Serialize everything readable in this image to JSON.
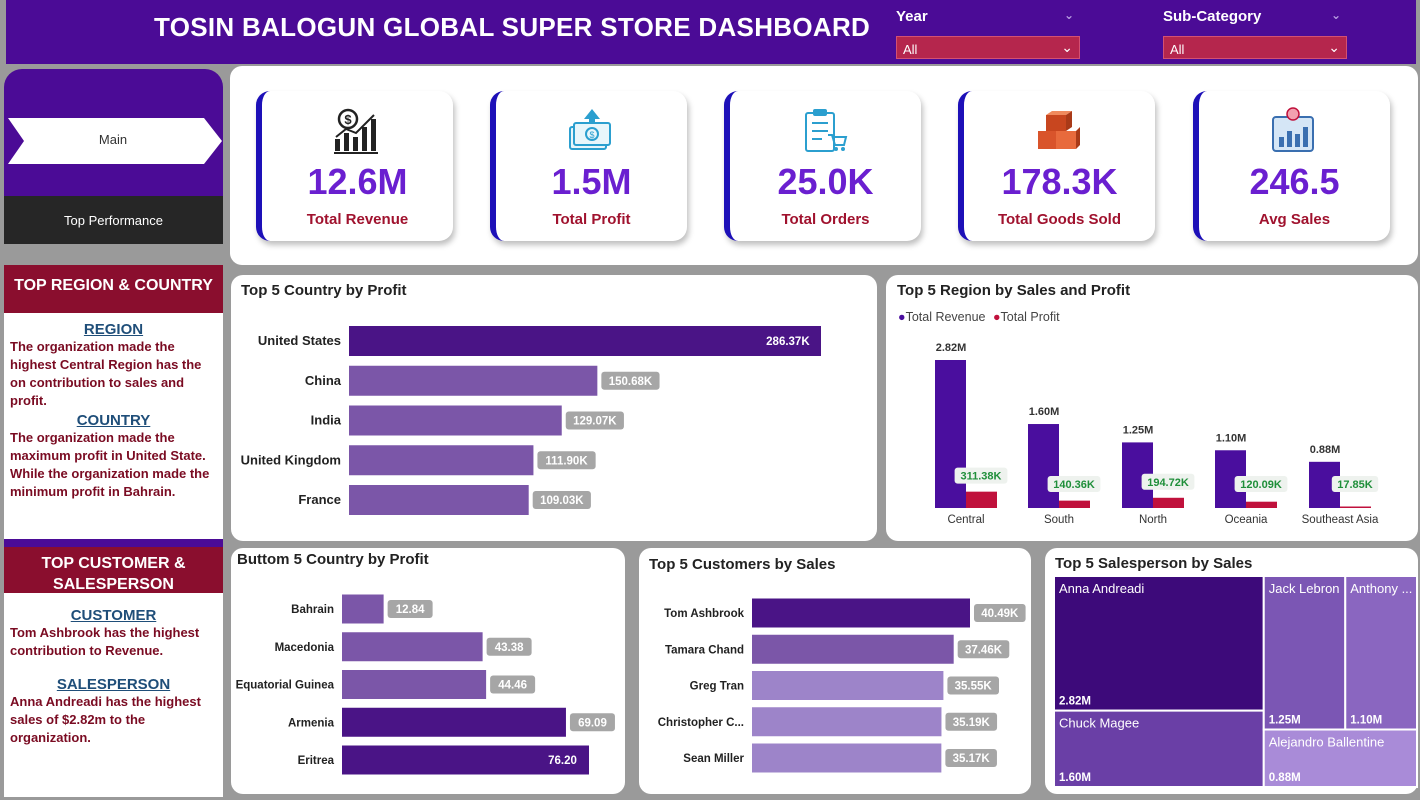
{
  "header": {
    "title": "TOSIN BALOGUN GLOBAL SUPER STORE DASHBOARD",
    "slicers": [
      {
        "label": "Year",
        "value": "All"
      },
      {
        "label": "Sub-Category",
        "value": "All"
      }
    ]
  },
  "sidebar": {
    "main_label": "Main",
    "top_perf_label": "Top Performance",
    "region_section": {
      "heading": "TOP REGION & COUNTRY",
      "region_title": "REGION",
      "region_text": "The organization made the highest Central Region has the on contribution to sales and profit.",
      "country_title": "COUNTRY",
      "country_text": "The organization made the maximum profit in United State. While the organization made the minimum profit in Bahrain."
    },
    "customer_section": {
      "heading": "TOP CUSTOMER & SALESPERSON",
      "customer_title": "CUSTOMER",
      "customer_text": "Tom Ashbrook has the highest contribution to Revenue.",
      "sales_title": "SALESPERSON",
      "sales_text": "Anna Andreadi has the highest sales of $2.82m to the organization."
    }
  },
  "kpis": [
    {
      "value": "12.6M",
      "label": "Total Revenue",
      "icon": "revenue-chart-icon"
    },
    {
      "value": "1.5M",
      "label": "Total Profit",
      "icon": "money-icon"
    },
    {
      "value": "25.0K",
      "label": "Total Orders",
      "icon": "clipboard-cart-icon"
    },
    {
      "value": "178.3K",
      "label": "Total Goods Sold",
      "icon": "boxes-icon"
    },
    {
      "value": "246.5",
      "label": "Avg Sales",
      "icon": "bar-chart-icon"
    }
  ],
  "colors": {
    "purple_dark": "#4a1486",
    "purple_mid": "#7b56a8",
    "purple_light": "#9d84c9",
    "crimson": "#c0113c",
    "label_green": "#1f8f3a"
  },
  "chart_data": [
    {
      "id": "top5-country-profit",
      "type": "bar",
      "orientation": "horizontal",
      "title": "Top 5 Country by Profit",
      "categories": [
        "United States",
        "China",
        "India",
        "United Kingdom",
        "France"
      ],
      "values": [
        286370,
        150680,
        129070,
        111900,
        109030
      ],
      "labels": [
        "286.37K",
        "150.68K",
        "129.07K",
        "111.90K",
        "109.03K"
      ]
    },
    {
      "id": "top5-region-sales-profit",
      "type": "bar",
      "title": "Top 5 Region by Sales and Profit",
      "categories": [
        "Central",
        "South",
        "North",
        "Oceania",
        "Southeast Asia"
      ],
      "legend_position": "top-left",
      "series": [
        {
          "name": "Total Revenue",
          "values": [
            2820000,
            1600000,
            1250000,
            1100000,
            880000
          ],
          "labels": [
            "2.82M",
            "1.60M",
            "1.25M",
            "1.10M",
            "0.88M"
          ]
        },
        {
          "name": "Total Profit",
          "values": [
            311380,
            140360,
            194720,
            120090,
            17850
          ],
          "labels": [
            "311.38K",
            "140.36K",
            "194.72K",
            "120.09K",
            "17.85K"
          ]
        }
      ]
    },
    {
      "id": "bottom5-country-profit",
      "type": "bar",
      "orientation": "horizontal",
      "title": "Buttom 5 Country by Profit",
      "categories": [
        "Bahrain",
        "Macedonia",
        "Equatorial Guinea",
        "Armenia",
        "Eritrea"
      ],
      "values": [
        12.84,
        43.38,
        44.46,
        69.09,
        76.2
      ],
      "labels": [
        "12.84",
        "43.38",
        "44.46",
        "69.09",
        "76.20"
      ]
    },
    {
      "id": "top5-customers-sales",
      "type": "bar",
      "orientation": "horizontal",
      "title": "Top 5 Customers by Sales",
      "categories": [
        "Tom Ashbrook",
        "Tamara Chand",
        "Greg Tran",
        "Christopher C...",
        "Sean Miller"
      ],
      "values": [
        40490,
        37460,
        35550,
        35190,
        35170
      ],
      "labels": [
        "40.49K",
        "37.46K",
        "35.55K",
        "35.19K",
        "35.17K"
      ]
    },
    {
      "id": "top5-salesperson-sales",
      "type": "treemap",
      "title": "Top 5 Salesperson by Sales",
      "categories": [
        "Anna Andreadi",
        "Chuck Magee",
        "Jack Lebron",
        "Anthony ...",
        "Alejandro Ballentine"
      ],
      "values": [
        2820000,
        1600000,
        1250000,
        1100000,
        880000
      ],
      "labels": [
        "2.82M",
        "1.60M",
        "1.25M",
        "1.10M",
        "0.88M"
      ]
    }
  ]
}
